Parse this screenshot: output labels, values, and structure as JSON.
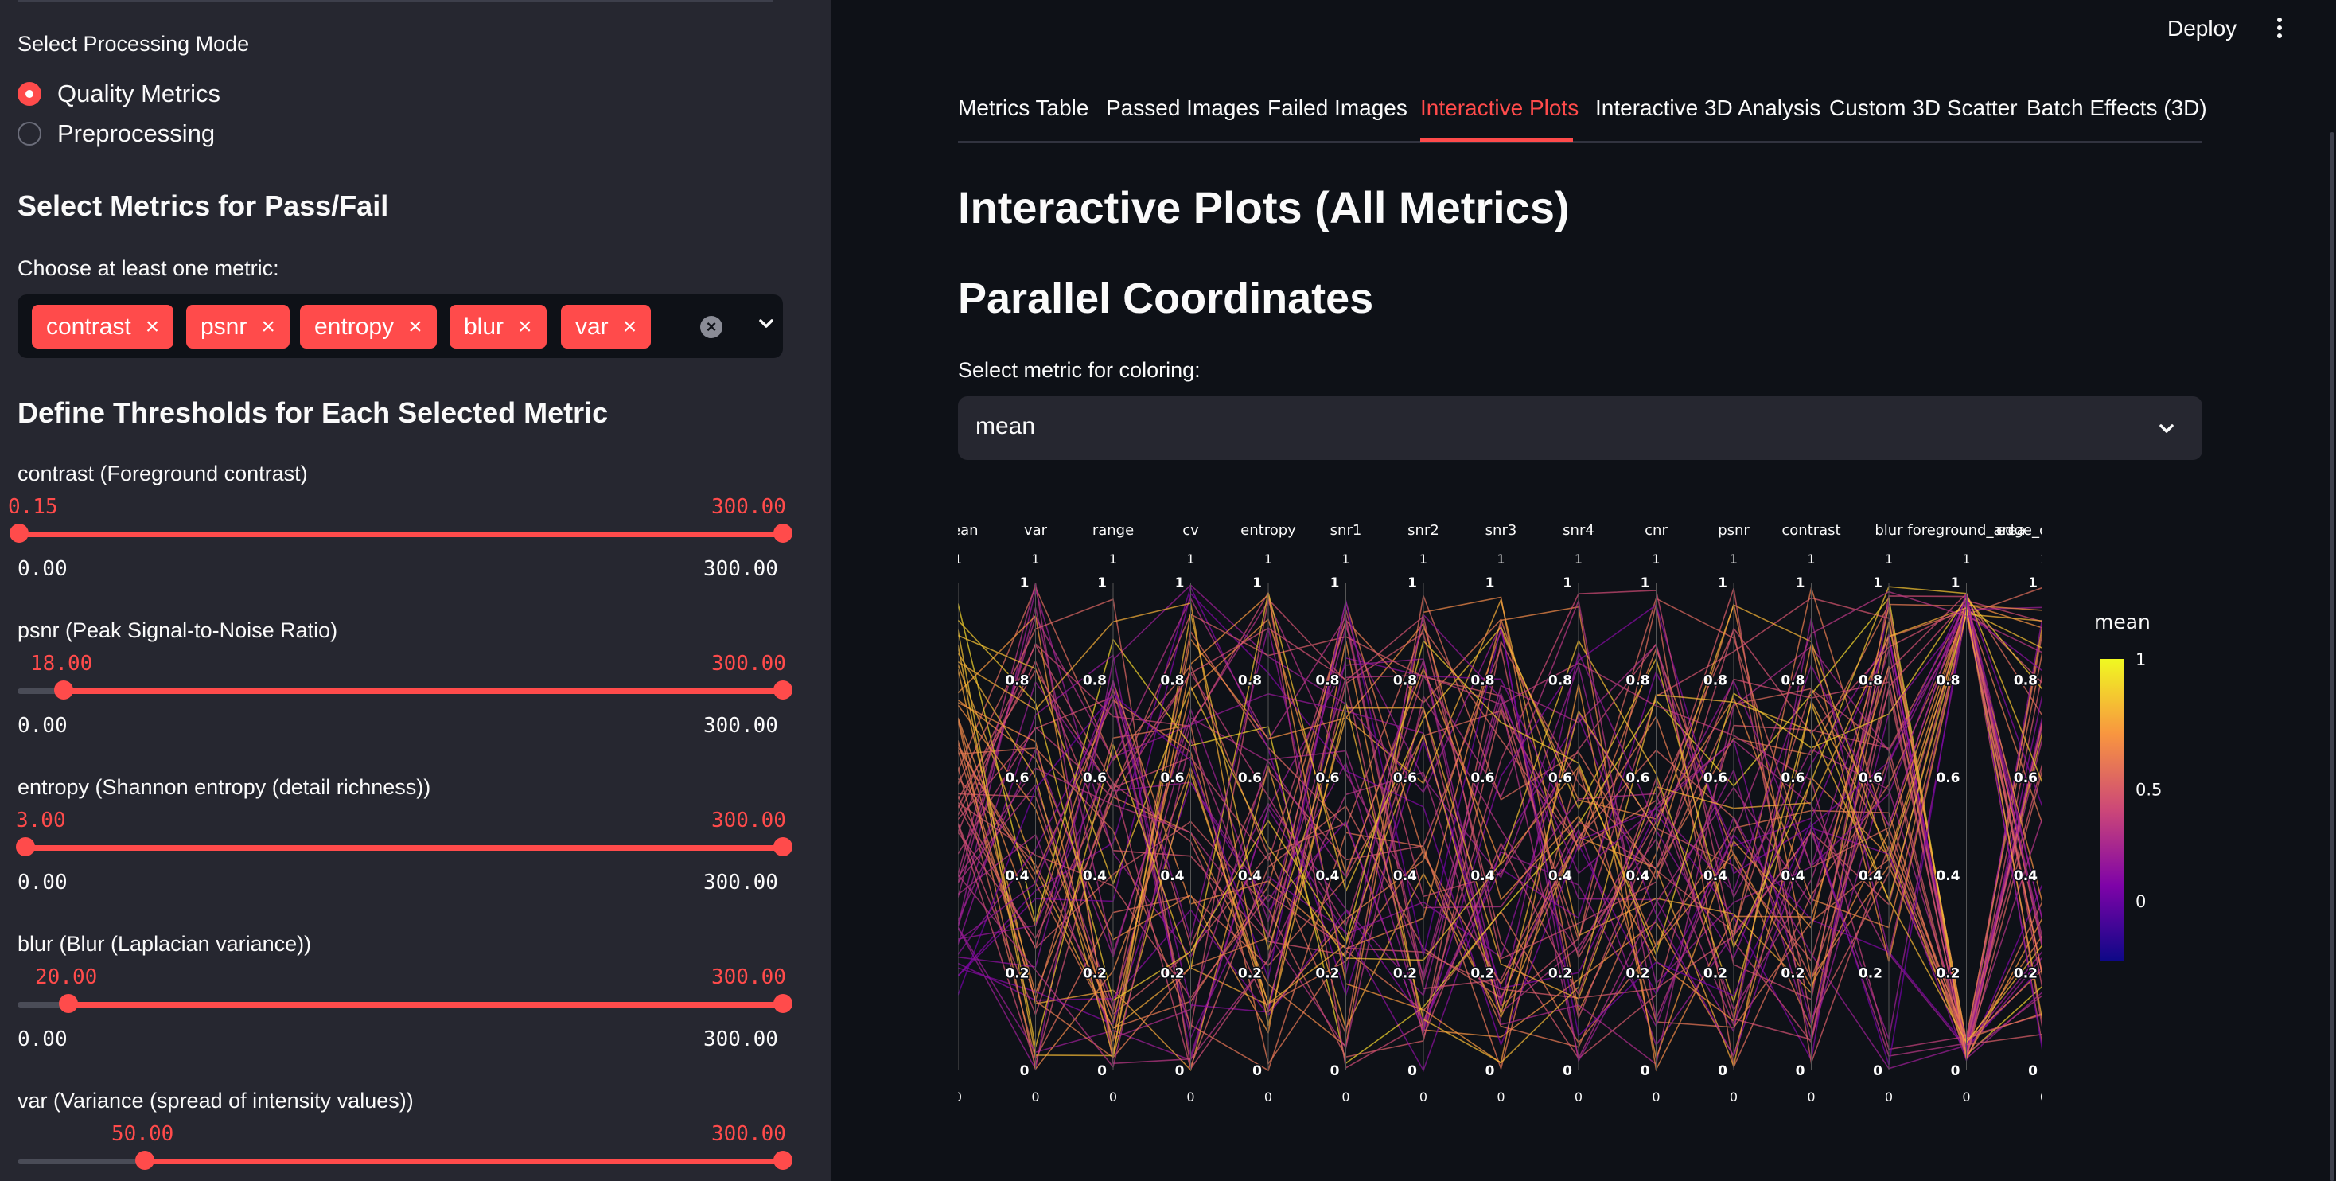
{
  "sidebar": {
    "mode_label": "Select Processing Mode",
    "modes": [
      {
        "label": "Quality Metrics",
        "selected": true
      },
      {
        "label": "Preprocessing",
        "selected": false
      }
    ],
    "metrics_heading": "Select Metrics for Pass/Fail",
    "choose_label": "Choose at least one metric:",
    "chips": [
      "contrast",
      "psnr",
      "entropy",
      "blur",
      "var"
    ],
    "thresholds_heading": "Define Thresholds for Each Selected Metric",
    "thresholds": [
      {
        "label": "contrast (Foreground contrast)",
        "value": "0.15",
        "max_value": "300.00",
        "min": "0.00",
        "max": "300.00",
        "lo": 0.15,
        "hi": 300
      },
      {
        "label": "psnr (Peak Signal-to-Noise Ratio)",
        "value": "18.00",
        "max_value": "300.00",
        "min": "0.00",
        "max": "300.00",
        "lo": 18,
        "hi": 300
      },
      {
        "label": "entropy (Shannon entropy (detail richness))",
        "value": "3.00",
        "max_value": "300.00",
        "min": "0.00",
        "max": "300.00",
        "lo": 3,
        "hi": 300
      },
      {
        "label": "blur (Blur (Laplacian variance))",
        "value": "20.00",
        "max_value": "300.00",
        "min": "0.00",
        "max": "300.00",
        "lo": 20,
        "hi": 300
      },
      {
        "label": "var (Variance (spread of intensity values))",
        "value": "50.00",
        "max_value": "300.00",
        "min": "",
        "max": "",
        "lo": 50,
        "hi": 300
      }
    ]
  },
  "header": {
    "deploy_label": "Deploy"
  },
  "tabs": [
    "Metrics Table",
    "Passed Images",
    "Failed Images",
    "Interactive Plots",
    "Interactive 3D Analysis",
    "Custom 3D Scatter",
    "Batch Effects (3D)"
  ],
  "active_tab": 3,
  "main": {
    "title": "Interactive Plots (All Metrics)",
    "subtitle": "Parallel Coordinates",
    "select_label": "Select metric for coloring:",
    "select_value": "mean"
  },
  "chart_data": {
    "type": "parallel_coordinates",
    "axes": [
      "mean",
      "var",
      "range",
      "cv",
      "entropy",
      "snr1",
      "snr2",
      "snr3",
      "snr4",
      "cnr",
      "psnr",
      "contrast",
      "blur",
      "foreground_area",
      "edge_density"
    ],
    "ticks": [
      "0",
      "0.2",
      "0.4",
      "0.6",
      "0.8",
      "1"
    ],
    "range_top": "1",
    "range_bottom": "0",
    "colorbar": {
      "title": "mean",
      "ticks": [
        "1",
        "0.5",
        "0"
      ],
      "colorscale": [
        "#0d0887",
        "#7e03a8",
        "#cc4778",
        "#f89540",
        "#f0f921"
      ]
    },
    "line_count": 60
  }
}
